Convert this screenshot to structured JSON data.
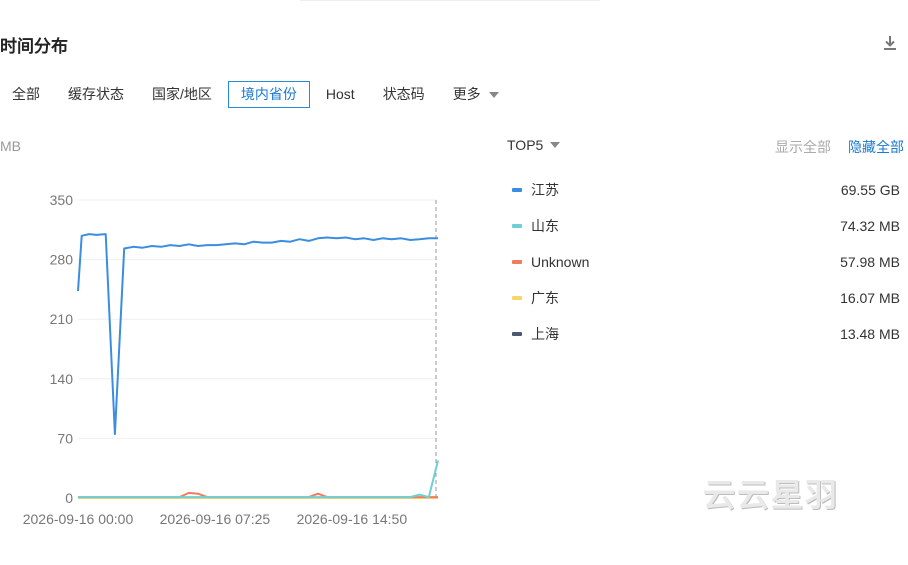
{
  "header": {
    "title": "时间分布"
  },
  "tabs": [
    {
      "label": "全部"
    },
    {
      "label": "缓存状态"
    },
    {
      "label": "国家/地区"
    },
    {
      "label": "境内省份"
    },
    {
      "label": "Host"
    },
    {
      "label": "状态码"
    },
    {
      "label": "更多"
    }
  ],
  "active_tab": "境内省份",
  "controls": {
    "top5": "TOP5",
    "show_all": "显示全部",
    "hide_all": "隐藏全部"
  },
  "legend": [
    {
      "name": "江苏",
      "value": "69.55 GB",
      "color": "#3b8de0"
    },
    {
      "name": "山东",
      "value": "74.32 MB",
      "color": "#6fcfd6"
    },
    {
      "name": "Unknown",
      "value": "57.98 MB",
      "color": "#f07c5c"
    },
    {
      "name": "广东",
      "value": "16.07 MB",
      "color": "#f7d567"
    },
    {
      "name": "上海",
      "value": "13.48 MB",
      "color": "#4a5a70"
    }
  ],
  "watermark": "云云星羽",
  "chart_data": {
    "type": "line",
    "ylabel": "MB",
    "ylim": [
      0,
      350
    ],
    "yticks": [
      0,
      70,
      140,
      210,
      280,
      350
    ],
    "xtick_labels": [
      "2026-09-16 00:00",
      "2026-09-16 07:25",
      "2026-09-16 14:50"
    ],
    "x_hours": [
      0,
      0.2,
      0.6,
      1,
      1.5,
      2,
      2.5,
      3,
      3.5,
      4,
      4.5,
      5,
      5.5,
      6,
      6.5,
      7,
      7.5,
      8,
      8.5,
      9,
      9.5,
      10,
      10.5,
      11,
      11.5,
      12,
      12.5,
      13,
      13.5,
      14,
      14.5,
      15,
      15.5,
      16,
      16.5,
      17,
      17.5,
      18,
      18.5,
      19,
      19.5
    ],
    "series": [
      {
        "name": "江苏",
        "color": "#3b8de0",
        "values": [
          243,
          308,
          310,
          309,
          310,
          75,
          293,
          295,
          294,
          296,
          295,
          297,
          296,
          298,
          296,
          297,
          297,
          298,
          299,
          298,
          301,
          300,
          300,
          302,
          301,
          304,
          302,
          305,
          306,
          305,
          306,
          304,
          305,
          303,
          305,
          304,
          305,
          303,
          304,
          305,
          305
        ]
      },
      {
        "name": "山东",
        "color": "#6fcfd6",
        "values": [
          1,
          1,
          1,
          1,
          1,
          1,
          1,
          1,
          1,
          1,
          1,
          1,
          1,
          1,
          1,
          1,
          1,
          1,
          1,
          1,
          1,
          1,
          1,
          1,
          1,
          1,
          1,
          1,
          1,
          1,
          1,
          1,
          1,
          1,
          1,
          1,
          1,
          1,
          4,
          1,
          44
        ]
      },
      {
        "name": "Unknown",
        "color": "#f07c5c",
        "values": [
          1,
          1,
          1,
          1,
          1,
          1,
          1,
          1,
          1,
          1,
          1,
          1,
          1,
          6,
          5,
          1,
          1,
          1,
          1,
          1,
          1,
          1,
          1,
          1,
          1,
          1,
          1,
          5,
          1,
          1,
          1,
          1,
          1,
          1,
          1,
          1,
          1,
          1,
          1,
          1,
          1
        ]
      },
      {
        "name": "广东",
        "color": "#f7d567",
        "values": [
          0,
          0,
          0,
          0,
          0,
          0,
          0,
          0,
          0,
          0,
          0,
          0,
          0,
          0,
          0,
          0,
          0,
          0,
          0,
          0,
          0,
          0,
          0,
          0,
          0,
          0,
          0,
          0,
          0,
          0,
          0,
          0,
          0,
          0,
          0,
          0,
          0,
          0,
          0,
          0,
          0
        ]
      },
      {
        "name": "上海",
        "color": "#4a5a70",
        "values": [
          0,
          0,
          0,
          0,
          0,
          0,
          0,
          0,
          0,
          0,
          0,
          0,
          0,
          0,
          0,
          0,
          0,
          0,
          0,
          0,
          0,
          0,
          0,
          0,
          0,
          0,
          0,
          0,
          0,
          0,
          0,
          0,
          0,
          0,
          0,
          0,
          0,
          0,
          0,
          0,
          0
        ]
      }
    ],
    "grid": true,
    "legend_position": "right"
  }
}
